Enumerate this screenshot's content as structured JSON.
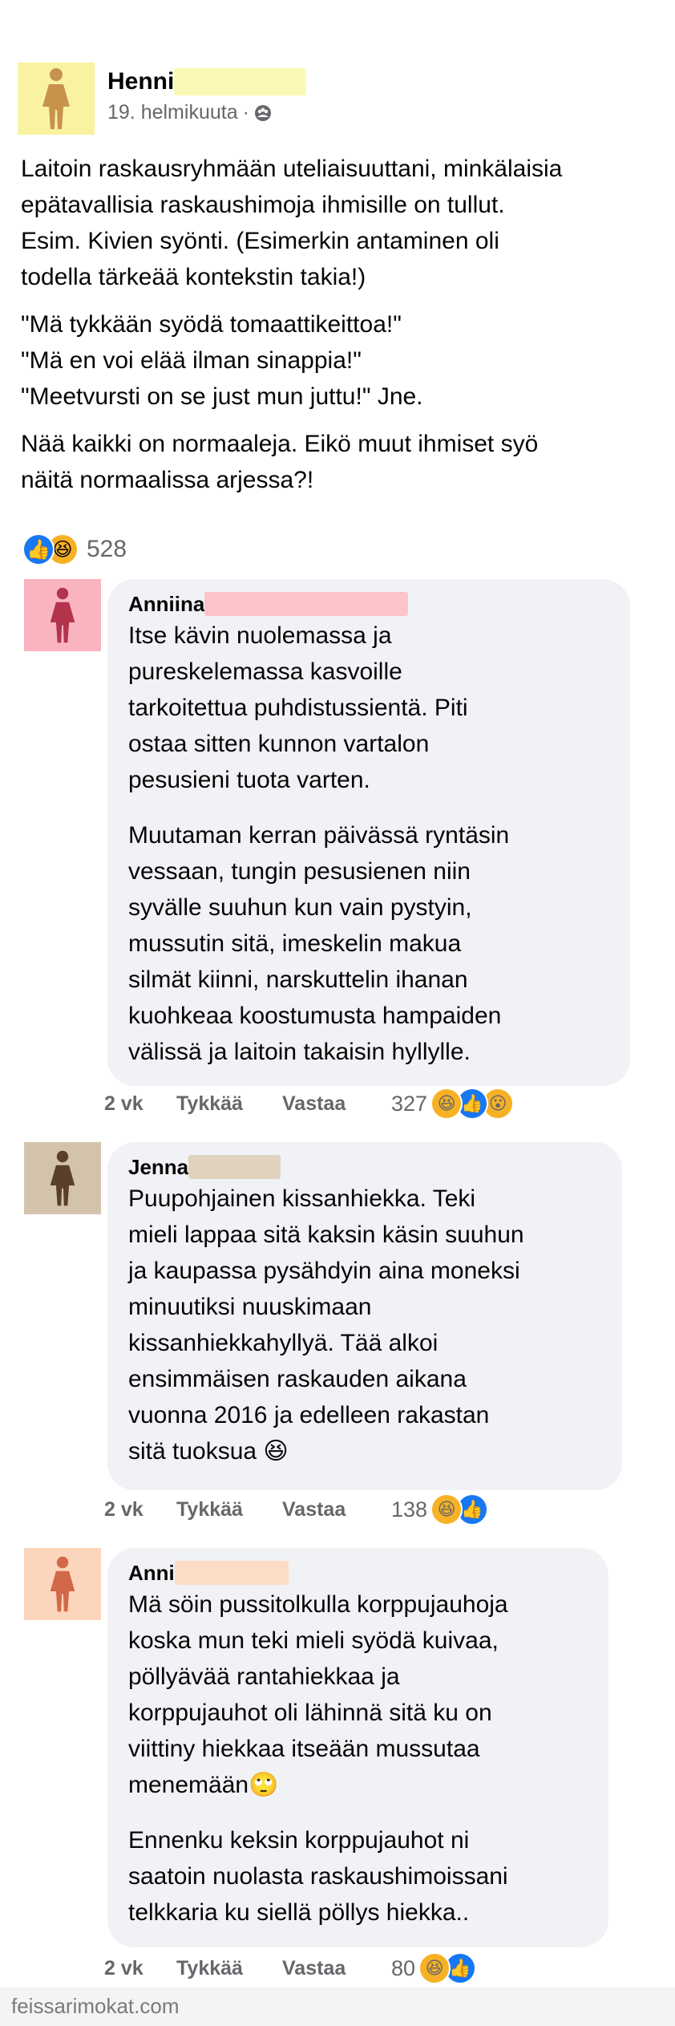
{
  "post": {
    "author_first": "Henni",
    "date": "19. helmikuuta",
    "privacy_icon": "group-icon",
    "avatar_color": "#f9f3a1",
    "figure_color": "#c7924c",
    "redact_color": "#fbf9b6",
    "body_lines": [
      [
        "Laitoin raskausryhmään uteliaisuuttani, minkälaisia",
        "epätavallisia raskaushimoja ihmisille on tullut.",
        "Esim. Kivien syönti. (Esimerkin antaminen oli",
        "todella tärkeää kontekstin takia!)"
      ],
      [
        "\"Mä tykkään syödä tomaattikeittoa!\"",
        "\"Mä en voi elää ilman sinappia!\"",
        "\"Meetvursti on se just mun juttu!\" Jne."
      ],
      [
        "Nää kaikki on normaaleja. Eikö muut ihmiset syö",
        "näitä normaalissa arjessa?!"
      ]
    ],
    "reaction_count": "528"
  },
  "comments": [
    {
      "name": "Anniina",
      "avatar_color": "#f9b4c0",
      "figure_color": "#b2344c",
      "redact_color": "#fcc3cb",
      "paragraphs": [
        [
          "Itse kävin nuolemassa ja",
          "pureskelemassa kasvoille",
          "tarkoitettua puhdistussientä. Piti",
          "ostaa sitten kunnon vartalon",
          "pesusieni tuota varten."
        ],
        [
          "Muutaman kerran päivässä ryntäsin",
          "vessaan, tungin pesusienen niin",
          "syvälle suuhun kun vain pystyin,",
          "mussutin sitä, imeskelin makua",
          "silmät kiinni, narskuttelin ihanan",
          "kuohkeaa koostumusta hampaiden",
          "välissä ja laitoin takaisin hyllylle."
        ]
      ],
      "time": "2 vk",
      "like_label": "Tykkää",
      "reply_label": "Vastaa",
      "count": "327",
      "reactions": [
        "haha",
        "like",
        "wow"
      ]
    },
    {
      "name": "Jenna",
      "avatar_color": "#d4c3ac",
      "figure_color": "#5a3f2d",
      "redact_color": "#e0d2bf",
      "paragraphs": [
        [
          "Puupohjainen kissanhiekka. Teki",
          "mieli lappaa sitä kaksin käsin suuhun",
          "ja kaupassa pysähdyin aina moneksi",
          "minuutiksi nuuskimaan",
          "kissanhiekkahyllyä. Tää alkoi",
          "ensimmäisen raskauden aikana",
          "vuonna 2016 ja edelleen rakastan",
          "sitä tuoksua 😆"
        ]
      ],
      "time": "2 vk",
      "like_label": "Tykkää",
      "reply_label": "Vastaa",
      "count": "138",
      "reactions": [
        "haha",
        "like"
      ]
    },
    {
      "name": "Anni",
      "avatar_color": "#fcd6bc",
      "figure_color": "#d2684a",
      "redact_color": "#fddcc6",
      "paragraphs": [
        [
          "Mä söin pussitolkulla korppujauhoja",
          "koska mun teki mieli syödä kuivaa,",
          "pöllyävää rantahiekkaa ja",
          "korppujauhot oli lähinnä sitä ku on",
          "viittiny hiekkaa itseään mussutaa",
          "menemään🙄"
        ],
        [
          "Ennenku keksin korppujauhot ni",
          "saatoin nuolasta raskaushimoissani",
          "telkkaria ku siellä pöllys hiekka.."
        ]
      ],
      "time": "2 vk",
      "like_label": "Tykkää",
      "reply_label": "Vastaa",
      "count": "80",
      "reactions": [
        "haha",
        "like"
      ]
    }
  ],
  "watermark": "feissarimokat.com"
}
